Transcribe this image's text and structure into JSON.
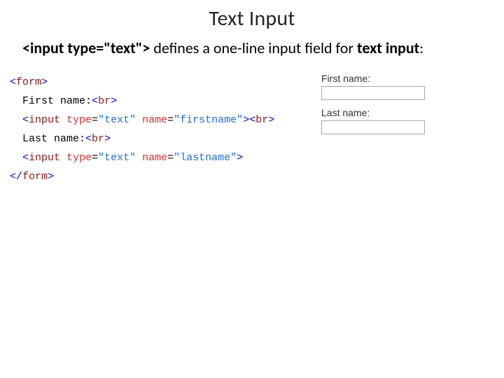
{
  "title": "Text Input",
  "desc": {
    "code": "<input type=\"text\">",
    "mid": " defines a one-line input field for ",
    "bold2": "text input",
    "tail": ":"
  },
  "code": {
    "l1": {
      "open": "<",
      "tag": "form",
      "close": ">"
    },
    "l2": {
      "indent": "  ",
      "text": "First name:",
      "brOpen": "<",
      "brTag": "br",
      "brClose": ">"
    },
    "l3": {
      "indent": "  ",
      "open": "<",
      "tag": "input",
      "sp1": " ",
      "attr1": "type",
      "eq1": "=",
      "val1": "\"text\"",
      "sp2": " ",
      "attr2": "name",
      "eq2": "=",
      "val2": "\"firstname\"",
      "close": ">",
      "brOpen": "<",
      "brTag": "br",
      "brClose": ">"
    },
    "l4": {
      "indent": "  ",
      "text": "Last name:",
      "brOpen": "<",
      "brTag": "br",
      "brClose": ">"
    },
    "l5": {
      "indent": "  ",
      "open": "<",
      "tag": "input",
      "sp1": " ",
      "attr1": "type",
      "eq1": "=",
      "val1": "\"text\"",
      "sp2": " ",
      "attr2": "name",
      "eq2": "=",
      "val2": "\"lastname\"",
      "close": ">"
    },
    "l6": {
      "open": "</",
      "tag": "form",
      "close": ">"
    }
  },
  "preview": {
    "label1": "First name:",
    "label2": "Last name:",
    "value1": "",
    "value2": ""
  }
}
